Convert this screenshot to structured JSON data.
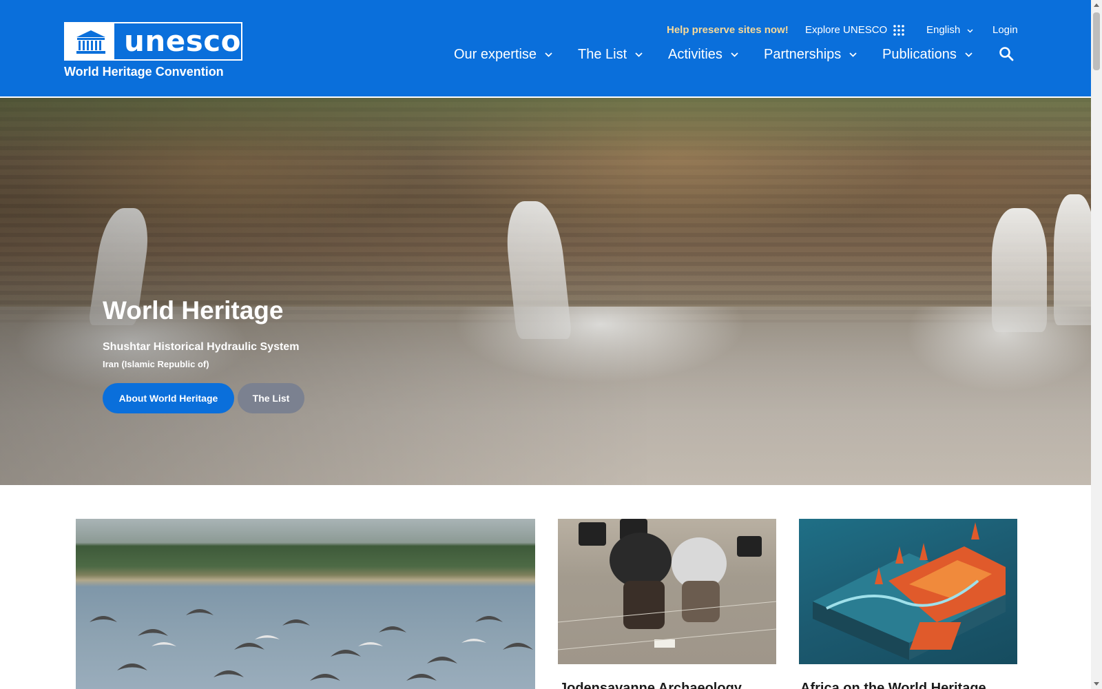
{
  "header": {
    "logo_word": "unesco",
    "convention": "World Heritage Convention",
    "util": {
      "help": "Help preserve sites now!",
      "explore": "Explore UNESCO",
      "language": "English",
      "login": "Login"
    },
    "nav": [
      {
        "label": "Our expertise"
      },
      {
        "label": "The List"
      },
      {
        "label": "Activities"
      },
      {
        "label": "Partnerships"
      },
      {
        "label": "Publications"
      }
    ],
    "icons": {
      "apps": "apps-grid-icon",
      "search": "search-icon",
      "chevron": "chevron-down-icon"
    }
  },
  "hero": {
    "title": "World Heritage",
    "site": "Shushtar Historical Hydraulic System",
    "country": "Iran (Islamic Republic of)",
    "primary_button": "About World Heritage",
    "secondary_button": "The List"
  },
  "cards": [
    {
      "title": ""
    },
    {
      "title": "Jodensavanne Archaeology"
    },
    {
      "title": "Africa on the World Heritage"
    }
  ],
  "colors": {
    "brand_blue": "#0a6fdb",
    "help_link": "#f6d99a",
    "secondary_button": "#7b8190"
  }
}
